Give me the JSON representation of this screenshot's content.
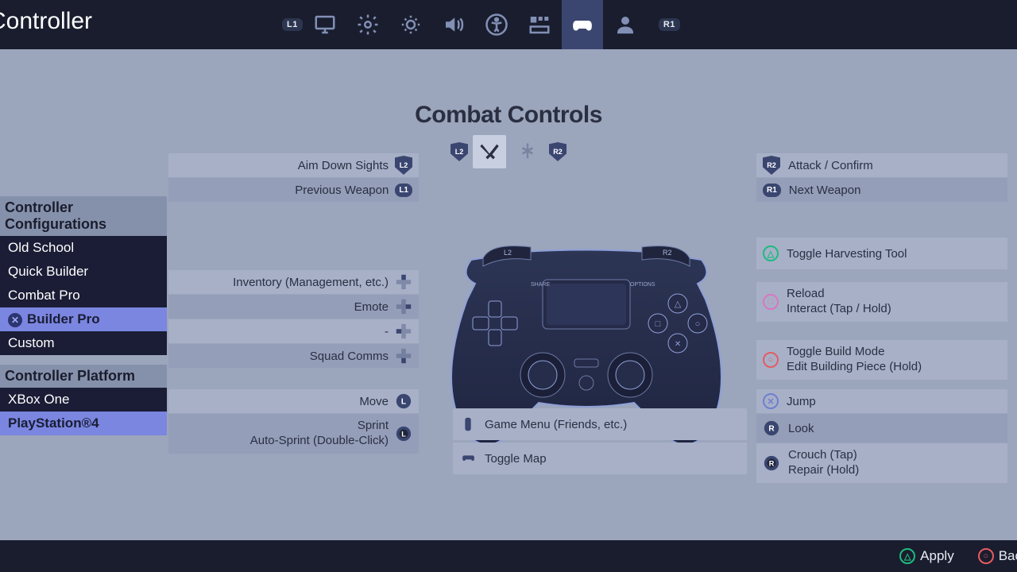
{
  "header": {
    "title": "Controller",
    "left_bumper": "L1",
    "right_bumper": "R1",
    "tabs": [
      "display",
      "gear",
      "brightness",
      "audio",
      "accessibility",
      "hud",
      "controller",
      "account"
    ],
    "active_tab": 6
  },
  "center": {
    "title": "Combat Controls",
    "left_badge": "L2",
    "right_badge": "R2",
    "modes": [
      "combat",
      "build"
    ],
    "active_mode": 0,
    "game_menu": "Game Menu (Friends, etc.)",
    "toggle_map": "Toggle Map"
  },
  "sidebar": {
    "config_heading": "Controller Configurations",
    "configs": [
      "Old School",
      "Quick Builder",
      "Combat Pro",
      "Builder Pro",
      "Custom"
    ],
    "selected_config": 3,
    "platform_heading": "Controller Platform",
    "platforms": [
      "XBox One",
      "PlayStation®4"
    ],
    "selected_platform": 1
  },
  "left_binds": {
    "g1": [
      {
        "label": "Aim Down Sights",
        "tag": "L2"
      },
      {
        "label": "Previous Weapon",
        "tag": "L1"
      }
    ],
    "g2": [
      {
        "label": "Inventory (Management, etc.)",
        "dpad": "up"
      },
      {
        "label": "Emote",
        "dpad": "right"
      },
      {
        "label": "-",
        "dpad": "left"
      },
      {
        "label": "Squad Comms",
        "dpad": "down"
      }
    ],
    "g3": [
      {
        "label": "Move",
        "stick": "L"
      },
      {
        "label": "Sprint",
        "sub": "Auto-Sprint (Double-Click)",
        "stick": "L"
      }
    ]
  },
  "right_binds": {
    "g1": [
      {
        "tag": "R2",
        "label": "Attack / Confirm"
      },
      {
        "tag": "R1",
        "label": "Next Weapon"
      }
    ],
    "g2": [
      {
        "btn": "triangle",
        "label": "Toggle Harvesting Tool"
      }
    ],
    "g3": [
      {
        "btn": "square",
        "label": "Reload",
        "sub": "Interact (Tap / Hold)"
      }
    ],
    "g4": [
      {
        "btn": "circle",
        "label": "Toggle Build Mode",
        "sub": "Edit Building Piece (Hold)"
      }
    ],
    "g5": [
      {
        "btn": "x",
        "label": "Jump"
      },
      {
        "stick": "R",
        "label": "Look"
      },
      {
        "stick": "R",
        "label": "Crouch (Tap)",
        "sub": "Repair (Hold)"
      }
    ]
  },
  "footer": {
    "apply": "Apply",
    "back": "Bac"
  }
}
